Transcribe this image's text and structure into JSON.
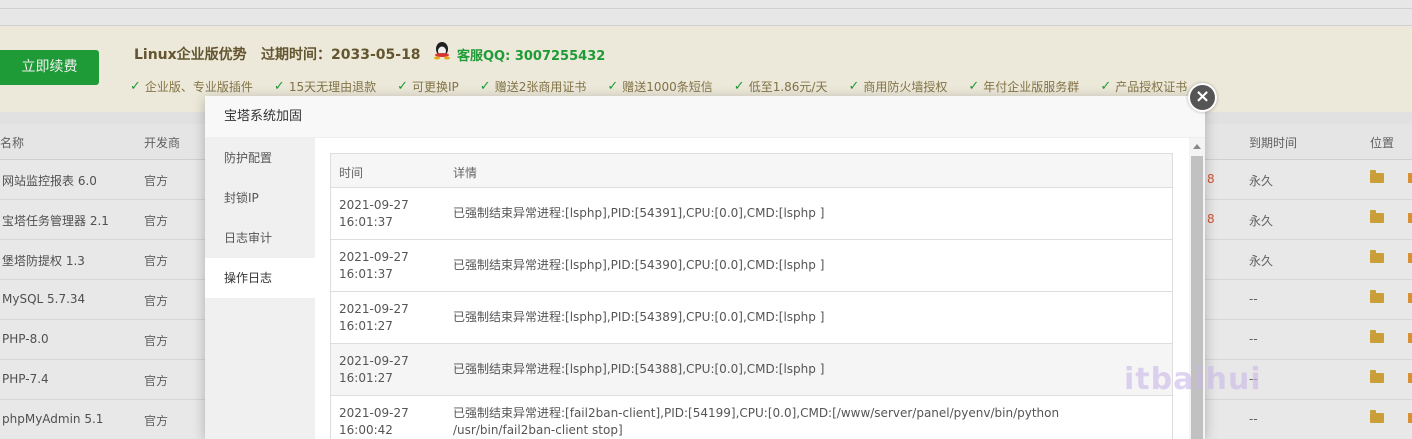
{
  "banner": {
    "renew_label": "立即续费",
    "title": "Linux企业版优势",
    "expire": "过期时间：2033-05-18",
    "qq": "客服QQ: 3007255432",
    "features": [
      "企业版、专业版插件",
      "15天无理由退款",
      "可更换IP",
      "赠送2张商用证书",
      "赠送1000条短信",
      "低至1.86元/天",
      "商用防火墙授权",
      "年付企业版服务群",
      "产品授权证书"
    ]
  },
  "table": {
    "col_name": "名称",
    "col_dev": "开发商",
    "col_expire": "到期时间",
    "col_location": "位置",
    "rows": [
      {
        "name": "网站监控报表 6.0",
        "dev": "官方",
        "expire": "永久",
        "price": "8"
      },
      {
        "name": "宝塔任务管理器 2.1",
        "dev": "官方",
        "expire": "永久",
        "price": "8"
      },
      {
        "name": "堡塔防提权 1.3",
        "dev": "官方",
        "expire": "永久",
        "price": ""
      },
      {
        "name": "MySQL 5.7.34",
        "dev": "官方",
        "expire": "--",
        "price": ""
      },
      {
        "name": "PHP-8.0",
        "dev": "官方",
        "expire": "--",
        "price": ""
      },
      {
        "name": "PHP-7.4",
        "dev": "官方",
        "expire": "--",
        "price": ""
      },
      {
        "name": "phpMyAdmin 5.1",
        "dev": "官方",
        "expire": "--",
        "price": ""
      }
    ]
  },
  "modal": {
    "title": "宝塔系统加固",
    "close_label": "×",
    "tabs": [
      "防护配置",
      "封锁IP",
      "日志审计",
      "操作日志"
    ],
    "log_headers": {
      "time": "时间",
      "detail": "详情"
    },
    "logs": [
      {
        "time": "2021-09-27 16:01:37",
        "detail": "已强制结束异常进程:[lsphp],PID:[54391],CPU:[0.0],CMD:[lsphp ]"
      },
      {
        "time": "2021-09-27 16:01:37",
        "detail": "已强制结束异常进程:[lsphp],PID:[54390],CPU:[0.0],CMD:[lsphp ]"
      },
      {
        "time": "2021-09-27 16:01:27",
        "detail": "已强制结束异常进程:[lsphp],PID:[54389],CPU:[0.0],CMD:[lsphp ]"
      },
      {
        "time": "2021-09-27 16:01:27",
        "detail": "已强制结束异常进程:[lsphp],PID:[54388],CPU:[0.0],CMD:[lsphp ]"
      },
      {
        "time": "2021-09-27 16:00:42",
        "detail": "已强制结束异常进程:[fail2ban-client],PID:[54199],CPU:[0.0],CMD:[/www/server/panel/pyenv/bin/python /usr/bin/fail2ban-client stop]"
      }
    ]
  },
  "watermark": "itbaihui",
  "colors": {
    "accent": "#20a53a",
    "banner_bg": "#fcf8e8",
    "folder": "#d8a93c"
  }
}
